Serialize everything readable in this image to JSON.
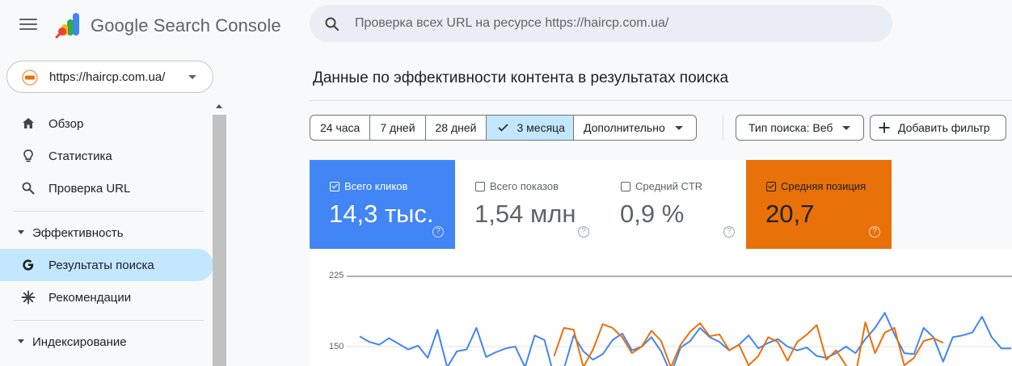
{
  "header": {
    "app_title": "Google Search Console",
    "search_placeholder": "Проверка всех URL на ресурсе https://haircp.com.ua/"
  },
  "property": {
    "url": "https://haircp.com.ua/"
  },
  "sidebar": {
    "items": [
      {
        "label": "Обзор",
        "icon": "home-icon"
      },
      {
        "label": "Статистика",
        "icon": "lightbulb-icon"
      },
      {
        "label": "Проверка URL",
        "icon": "search-icon"
      }
    ],
    "sections": [
      {
        "label": "Эффективность",
        "items": [
          {
            "label": "Результаты поиска",
            "icon": "google-g-icon",
            "active": true
          },
          {
            "label": "Рекомендации",
            "icon": "sparkle-icon"
          }
        ]
      },
      {
        "label": "Индексирование"
      }
    ]
  },
  "main": {
    "title": "Данные по эффективности контента в результатах поиска",
    "date_ranges": [
      "24 часа",
      "7 дней",
      "28 дней",
      "3 месяца",
      "Дополнительно"
    ],
    "selected_range": "3 месяца",
    "search_type": "Тип поиска: Веб",
    "add_filter": "Добавить фильтр",
    "help_glyph": "?",
    "metrics": [
      {
        "label": "Всего кликов",
        "value": "14,3 тыс.",
        "checked": true,
        "color": "#4285f4"
      },
      {
        "label": "Всего показов",
        "value": "1,54 млн",
        "checked": false
      },
      {
        "label": "Средний CTR",
        "value": "0,9 %",
        "checked": false
      },
      {
        "label": "Средняя позиция",
        "value": "20,7",
        "checked": true,
        "color": "#e8710a"
      }
    ]
  },
  "chart_data": {
    "type": "line",
    "y_ticks": [
      "225",
      "150"
    ],
    "series": [
      {
        "color": "#4285f4",
        "values": [
          161,
          155,
          152,
          159,
          153,
          147,
          151,
          138,
          168,
          128,
          145,
          147,
          170,
          139,
          144,
          148,
          150,
          128,
          162,
          157,
          118,
          126,
          162,
          145,
          136,
          142,
          157,
          164,
          146,
          150,
          160,
          145,
          121,
          149,
          156,
          170,
          160,
          155,
          146,
          152,
          162,
          148,
          154,
          158,
          150,
          146,
          149,
          140,
          138,
          143,
          150,
          143,
          158,
          170,
          186,
          163,
          143,
          142,
          170,
          160,
          134,
          160,
          162,
          165,
          182,
          160,
          148,
          148
        ]
      },
      {
        "color": "#e8710a",
        "values": [
          null,
          null,
          null,
          null,
          null,
          null,
          null,
          null,
          null,
          null,
          null,
          null,
          null,
          null,
          null,
          null,
          null,
          null,
          null,
          null,
          140,
          170,
          168,
          128,
          147,
          174,
          170,
          160,
          143,
          150,
          167,
          156,
          128,
          152,
          166,
          175,
          161,
          163,
          146,
          152,
          130,
          140,
          160,
          155,
          135,
          155,
          163,
          173,
          136,
          146,
          130,
          120,
          176,
          143,
          165,
          170,
          130,
          138,
          156,
          159,
          154,
          null,
          null,
          null,
          null,
          null,
          null,
          null
        ]
      }
    ]
  }
}
